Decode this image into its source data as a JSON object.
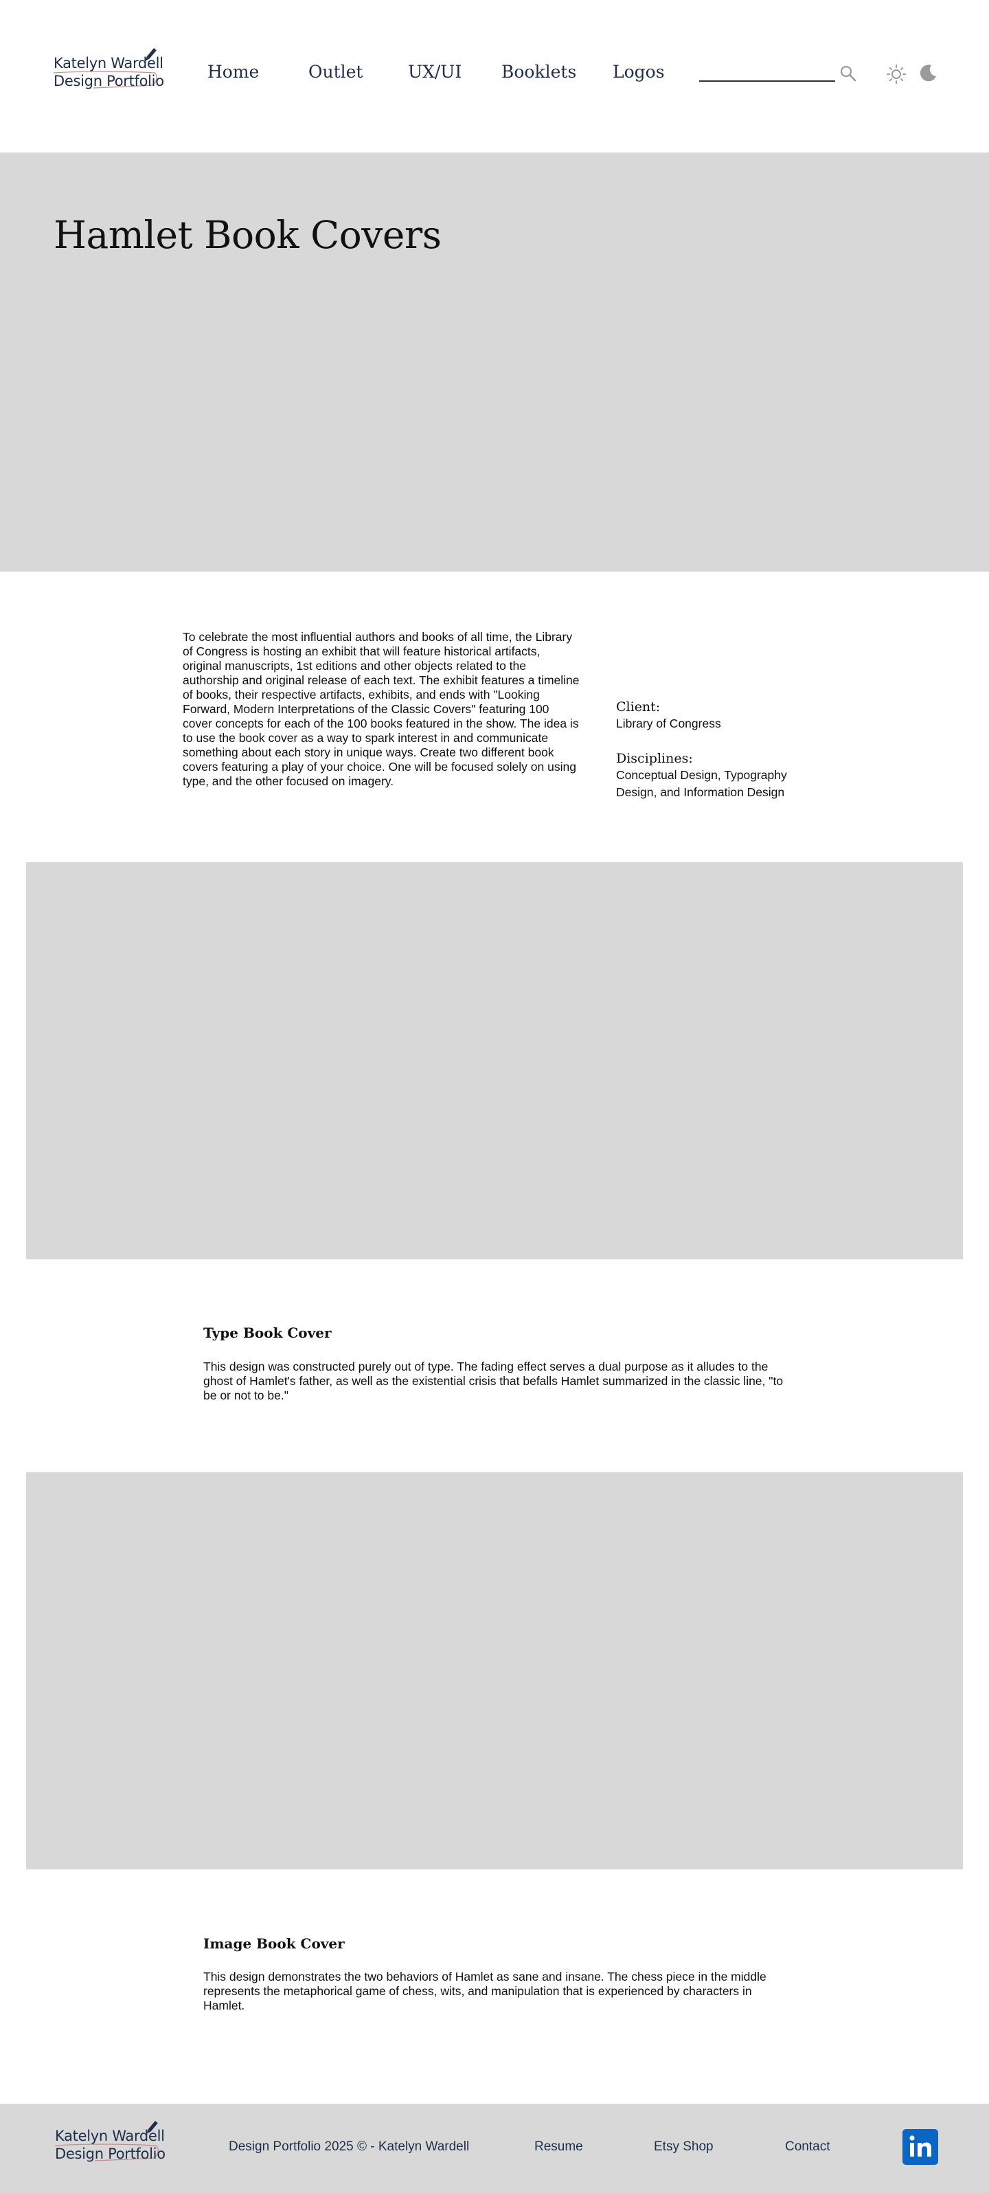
{
  "header": {
    "logo": {
      "line1": "Katelyn Wardell",
      "line2": "Design Portfolio"
    },
    "nav": [
      {
        "label": "Home"
      },
      {
        "label": "Outlet"
      },
      {
        "label": "UX/UI"
      },
      {
        "label": "Booklets"
      },
      {
        "label": "Logos"
      }
    ],
    "search": {
      "value": "",
      "placeholder": ""
    },
    "icons": [
      "search-icon",
      "sun-icon",
      "moon-icon"
    ]
  },
  "hero": {
    "title": "Hamlet Book Covers"
  },
  "intro": {
    "text": "To celebrate the most influential authors and books of all time, the Library of Congress is hosting an exhibit that will feature historical artifacts, original manuscripts, 1st editions and other objects related to the authorship and original release of each text. The exhibit features a timeline of books, their respective artifacts, exhibits, and ends with \"Looking Forward, Modern Interpretations of the Classic Covers\" featuring 100 cover concepts for each of the 100 books featured in the show. The idea is to use the book cover as a way to spark interest in and communicate something about each story in unique ways. Create two different book covers featuring a play of your choice. One will be focused solely on using type, and the other focused on imagery.",
    "client_label": "Client:",
    "client_value": "Library of Congress",
    "disciplines_label": "Disciplines:",
    "disciplines_value": "Conceptual Design, Typography Design, and Information Design"
  },
  "sections": [
    {
      "title": "Type Book Cover",
      "text": "This design was constructed purely out of type. The fading effect serves a dual purpose as it alludes to the ghost of Hamlet's father, as well as the existential crisis that befalls Hamlet summarized in the classic line, \"to be or not to be.\""
    },
    {
      "title": "Image Book Cover",
      "text": "This design demonstrates the two behaviors of Hamlet as sane and insane. The chess piece in the middle represents the metaphorical game of chess, wits, and manipulation that is experienced by characters in Hamlet."
    }
  ],
  "footer": {
    "logo": {
      "line1": "Katelyn Wardell",
      "line2": "Design Portfolio"
    },
    "copyright": "Design Portfolio 2025 © - Katelyn Wardell",
    "links": [
      {
        "label": "Resume"
      },
      {
        "label": "Etsy Shop"
      },
      {
        "label": "Contact"
      }
    ],
    "social_icon": "linkedin-icon"
  },
  "colors": {
    "placeholder_gray": "#d8d8d8",
    "nav_text": "#1f2f4a",
    "linkedin_blue": "#0a66c2",
    "icon_gray": "#9a9a9a"
  }
}
